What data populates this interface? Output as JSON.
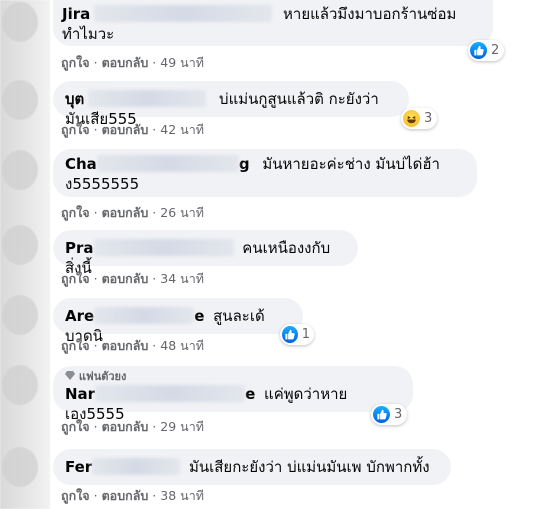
{
  "comments": [
    {
      "name": "Jira",
      "text": "หายแล้วมึงมาบอกร้านซ่อม ทำไมวะ",
      "text_line2": "ทำไมวะ",
      "like": "ถูกใจ",
      "reply": "ตอบกลับ",
      "time": "49 นาที",
      "reaction": {
        "type": "like",
        "count": "2"
      }
    },
    {
      "name": "บุต",
      "text": "บ่แม่นกูสูนแล้วติ กะยังว่ามันเสีย555",
      "like": "ถูกใจ",
      "reply": "ตอบกลับ",
      "time": "42 นาที",
      "reaction": {
        "type": "haha",
        "count": "3"
      }
    },
    {
      "name": "Cha",
      "name_tail": "g",
      "text": "มันหายอะค่ะช่าง มันบ่ได่ฮ้า",
      "text_line2": "ง5555555",
      "like": "ถูกใจ",
      "reply": "ตอบกลับ",
      "time": "26 นาที"
    },
    {
      "name": "Pra",
      "text": "คนเหนืองงกับสิ่งนี้",
      "like": "ถูกใจ",
      "reply": "ตอบกลับ",
      "time": "34 นาที"
    },
    {
      "name": "Are",
      "name_tail": "e",
      "text": "สูนละเด้บาดนิ",
      "like": "ถูกใจ",
      "reply": "ตอบกลับ",
      "time": "48 นาที",
      "reaction": {
        "type": "like",
        "count": "1"
      }
    },
    {
      "name": "Nar",
      "name_tail": "e",
      "badge": "แฟนตัวยง",
      "text": "แค่พูดว่าหายเอง5555",
      "like": "ถูกใจ",
      "reply": "ตอบกลับ",
      "time": "29 นาที",
      "reaction": {
        "type": "like",
        "count": "3"
      }
    },
    {
      "name": "Fer",
      "text": "มันเสียกะยังว่า บ่แม่นมันเพ บักพากทั้ง",
      "like": "ถูกใจ",
      "reply": "ตอบกลับ",
      "time": "38 นาที"
    }
  ],
  "icons": {
    "like": "thumbs-up-icon",
    "haha": "laughing-face-icon",
    "badge": "diamond-icon"
  },
  "colors": {
    "bubble": "#f0f2f5",
    "meta": "#65676b",
    "like_blue": "#1877f2"
  }
}
